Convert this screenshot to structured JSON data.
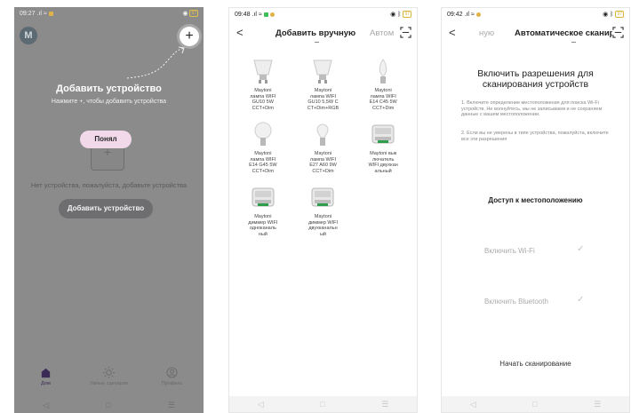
{
  "phone1": {
    "status": {
      "time": "09:27",
      "battery": "97"
    },
    "logo": "M",
    "plus": "+",
    "title": "Добавить устройство",
    "hint": "Нажмите +, чтобы добавить устройства",
    "got_it": "Понял",
    "empty_text": "Нет устройства, пожалуйста, добавьте устройства",
    "add_button": "Добавить устройство",
    "tabs": [
      {
        "label": "Дом",
        "icon": "home-icon"
      },
      {
        "label": "Умные сценарии",
        "icon": "sun-icon"
      },
      {
        "label": "Профиль",
        "icon": "profile-icon"
      }
    ],
    "nav": [
      "◁",
      "□",
      "☰"
    ]
  },
  "phone2": {
    "status": {
      "time": "09:48",
      "battery": "97"
    },
    "back": "<",
    "title": "Добавить вручную",
    "other_tab": "Автом",
    "devices": [
      {
        "name": "Maytoni\nлампа WIFI\nGU10 5W\nCCT+Dim",
        "icon": "gu10-bulb-icon"
      },
      {
        "name": "Maytoni\nлампа WIFI\nGU10 5,5W C\nCT+Dim+RGB",
        "icon": "gu10-bulb-icon"
      },
      {
        "name": "Maytoni\nлампа WIFI\nE14 C45 5W\nCCT+Dim",
        "icon": "candle-bulb-icon"
      },
      {
        "name": "Maytoni\nлампа WIFI\nE14 G45 5W\nCCT+Dim",
        "icon": "globe-bulb-icon"
      },
      {
        "name": "Maytoni\nлампа WIFI\nE27 A60 9W\nCCT+Dim",
        "icon": "a60-bulb-icon"
      },
      {
        "name": "Maytoni вык\nлючатель\nWIFI двухкан\nальный",
        "icon": "switch-module-icon"
      },
      {
        "name": "Maytoni\nдиммер WIFI\nодноканаль\nный",
        "icon": "dimmer-module-icon"
      },
      {
        "name": "Maytoni\nдиммер WIFI\nдвухканальн\nый",
        "icon": "dimmer-module-icon"
      }
    ],
    "nav": [
      "◁",
      "□",
      "☰"
    ]
  },
  "phone3": {
    "status": {
      "time": "09:42",
      "battery": "97"
    },
    "back": "<",
    "prev_tab": "ную",
    "title": "Автоматическое сканир",
    "heading": "Включить разрешения для\nсканирования устройств",
    "para1": "1. Включите определение местоположения для поиска Wi-Fi устройств. Не волнуйтесь, мы не записываем и не сохраняем данные с вашем местоположении.",
    "para2": "2. Если вы не уверены в типе устройства, пожалуйста, включите все эти разрешения",
    "location": "Доступ к местоположению",
    "wifi": "Включить Wi-Fi",
    "bluetooth": "Включить Bluetooth",
    "check": "✓",
    "start": "Начать сканирование",
    "nav": [
      "◁",
      "□",
      "☰"
    ]
  },
  "colors": {
    "overlay_gray": "#8b8b8b",
    "got_it_pink": "#f1d9ea",
    "home_purple": "#3a2a55",
    "muted_text": "#aaaaaa"
  }
}
